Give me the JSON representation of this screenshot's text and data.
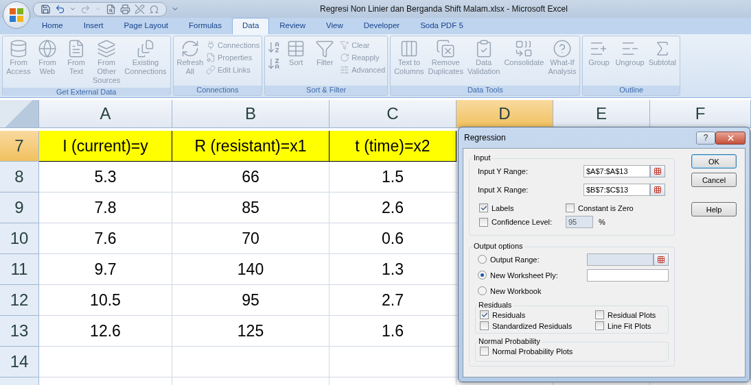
{
  "window": {
    "title": "Regresi Non Linier dan Berganda Shift Malam.xlsx - Microsoft Excel"
  },
  "tabs": [
    {
      "label": "Home",
      "selected": false
    },
    {
      "label": "Insert",
      "selected": false
    },
    {
      "label": "Page Layout",
      "selected": false
    },
    {
      "label": "Formulas",
      "selected": false
    },
    {
      "label": "Data",
      "selected": true
    },
    {
      "label": "Review",
      "selected": false
    },
    {
      "label": "View",
      "selected": false
    },
    {
      "label": "Developer",
      "selected": false
    },
    {
      "label": "Soda PDF 5",
      "selected": false
    }
  ],
  "ribbon_groups": [
    {
      "title": "Get External Data",
      "items": [
        {
          "kind": "large",
          "label": "From Access"
        },
        {
          "kind": "large",
          "label": "From Web"
        },
        {
          "kind": "large",
          "label": "From Text"
        },
        {
          "kind": "large",
          "label": "From Other Sources"
        },
        {
          "kind": "large",
          "label": "Existing Connections"
        }
      ]
    },
    {
      "title": "Connections",
      "items": [
        {
          "kind": "large",
          "label": "Refresh All"
        },
        {
          "kind": "small",
          "label": "Connections"
        },
        {
          "kind": "small",
          "label": "Properties"
        },
        {
          "kind": "small",
          "label": "Edit Links"
        }
      ]
    },
    {
      "title": "Sort & Filter",
      "items": [
        {
          "kind": "icon"
        },
        {
          "kind": "icon"
        },
        {
          "kind": "large",
          "label": "Sort"
        },
        {
          "kind": "large",
          "label": "Filter"
        },
        {
          "kind": "small",
          "label": "Clear"
        },
        {
          "kind": "small",
          "label": "Reapply"
        },
        {
          "kind": "small",
          "label": "Advanced"
        }
      ]
    },
    {
      "title": "Data Tools",
      "items": [
        {
          "kind": "large",
          "label": "Text to Columns"
        },
        {
          "kind": "large",
          "label": "Remove Duplicates"
        },
        {
          "kind": "large",
          "label": "Data Validation"
        },
        {
          "kind": "large",
          "label": "Consolidate"
        },
        {
          "kind": "large",
          "label": "What-If Analysis"
        }
      ]
    },
    {
      "title": "Outline",
      "items": [
        {
          "kind": "large",
          "label": "Group"
        },
        {
          "kind": "large",
          "label": "Ungroup"
        },
        {
          "kind": "large",
          "label": "Subtotal"
        }
      ]
    }
  ],
  "sheet": {
    "columns": [
      {
        "label": "A",
        "selected": false
      },
      {
        "label": "B",
        "selected": false
      },
      {
        "label": "C",
        "selected": false
      },
      {
        "label": "D",
        "selected": true
      },
      {
        "label": "E",
        "selected": false
      },
      {
        "label": "F",
        "selected": false
      }
    ],
    "rows": [
      {
        "number": "7",
        "highlighted": true,
        "cells": [
          "I (current)=y",
          "R (resistant)=x1",
          "t (time)=x2"
        ]
      },
      {
        "number": "8",
        "highlighted": false,
        "cells": [
          "5.3",
          "66",
          "1.5"
        ]
      },
      {
        "number": "9",
        "highlighted": false,
        "cells": [
          "7.8",
          "85",
          "2.6"
        ]
      },
      {
        "number": "10",
        "highlighted": false,
        "cells": [
          "7.6",
          "70",
          "0.6"
        ]
      },
      {
        "number": "11",
        "highlighted": false,
        "cells": [
          "9.7",
          "140",
          "1.3"
        ]
      },
      {
        "number": "12",
        "highlighted": false,
        "cells": [
          "10.5",
          "95",
          "2.7"
        ]
      },
      {
        "number": "13",
        "highlighted": false,
        "cells": [
          "12.6",
          "125",
          "1.6"
        ]
      },
      {
        "number": "14",
        "highlighted": false,
        "cells": []
      }
    ]
  },
  "dialog": {
    "title": "Regression",
    "help_glyph": "?",
    "input": {
      "title": "Input",
      "y_range": {
        "label": "Input Y Range:",
        "value": "$A$7:$A$13"
      },
      "x_range": {
        "label": "Input X Range:",
        "value": "$B$7:$C$13"
      },
      "labels": {
        "label": "Labels",
        "checked": true
      },
      "constant_zero": {
        "label": "Constant is Zero",
        "checked": false
      },
      "confidence": {
        "label": "Confidence Level:",
        "checked": false,
        "value": "95",
        "unit": "%"
      }
    },
    "output": {
      "title": "Output options",
      "options": [
        {
          "label": "Output Range:",
          "selected": false,
          "kind": "range_field"
        },
        {
          "label": "New Worksheet Ply:",
          "selected": true,
          "kind": "text_field"
        },
        {
          "label": "New Workbook",
          "selected": false
        }
      ],
      "residuals": {
        "title": "Residuals",
        "items": [
          {
            "label": "Residuals",
            "checked": true
          },
          {
            "label": "Residual Plots",
            "checked": false
          },
          {
            "label": "Standardized Residuals",
            "checked": false
          },
          {
            "label": "Line Fit Plots",
            "checked": false
          }
        ]
      },
      "normal": {
        "title": "Normal Probability",
        "items": [
          {
            "label": "Normal Probability Plots",
            "checked": false
          }
        ]
      }
    },
    "buttons": [
      {
        "label": "OK",
        "default": true
      },
      {
        "label": "Cancel",
        "default": false
      },
      {
        "label": "Help",
        "default": false
      }
    ]
  }
}
